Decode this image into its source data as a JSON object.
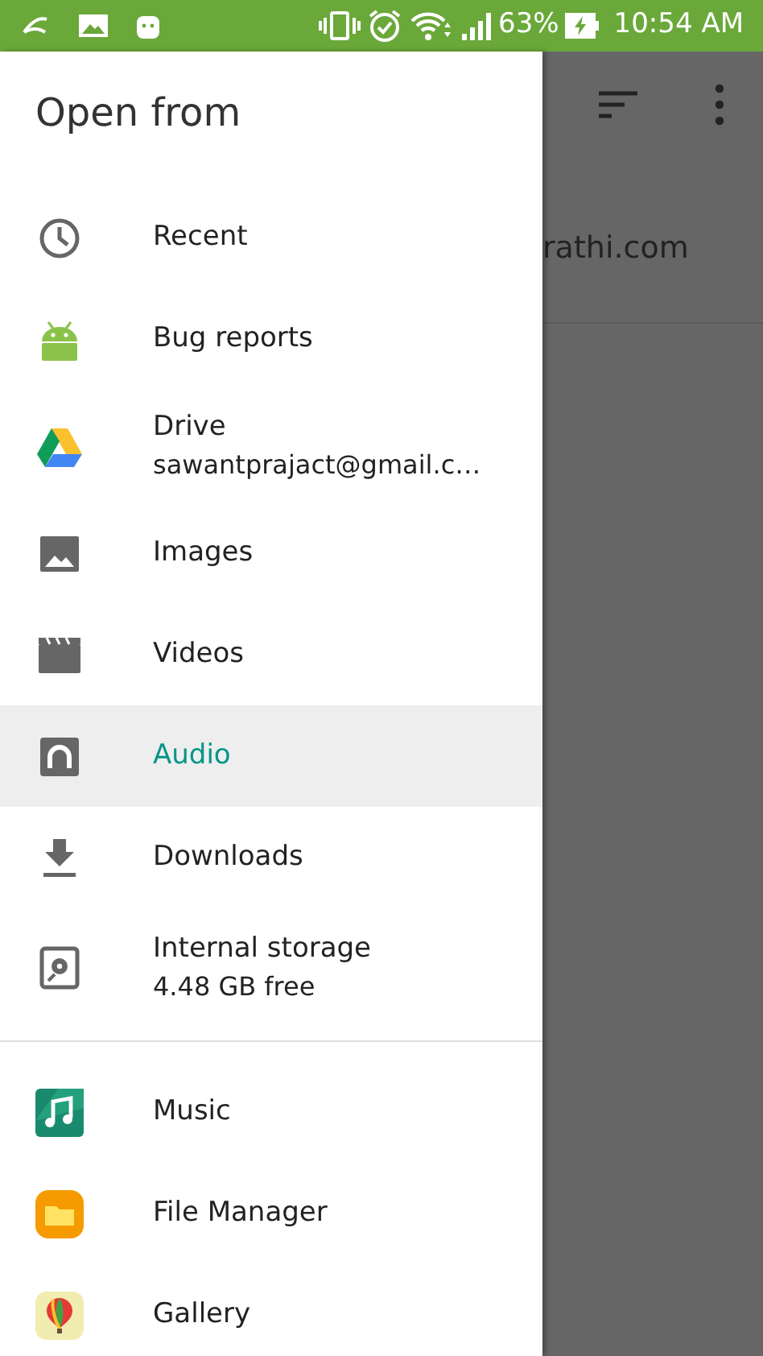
{
  "status_bar": {
    "battery": "63%",
    "time": "10:54 AM"
  },
  "background": {
    "text": "rathi.com"
  },
  "drawer": {
    "title": "Open from",
    "sections": [
      [
        {
          "label": "Recent",
          "selected": false
        },
        {
          "label": "Bug reports",
          "selected": false
        },
        {
          "label": "Drive",
          "subtitle": "sawantprajact@gmail.c…",
          "selected": false
        },
        {
          "label": "Images",
          "selected": false
        },
        {
          "label": "Videos",
          "selected": false
        },
        {
          "label": "Audio",
          "selected": true
        },
        {
          "label": "Downloads",
          "selected": false
        },
        {
          "label": "Internal storage",
          "subtitle": "4.48 GB free",
          "selected": false
        }
      ],
      [
        {
          "label": "Music",
          "selected": false
        },
        {
          "label": "File Manager",
          "selected": false
        },
        {
          "label": "Gallery",
          "selected": false
        }
      ]
    ]
  }
}
